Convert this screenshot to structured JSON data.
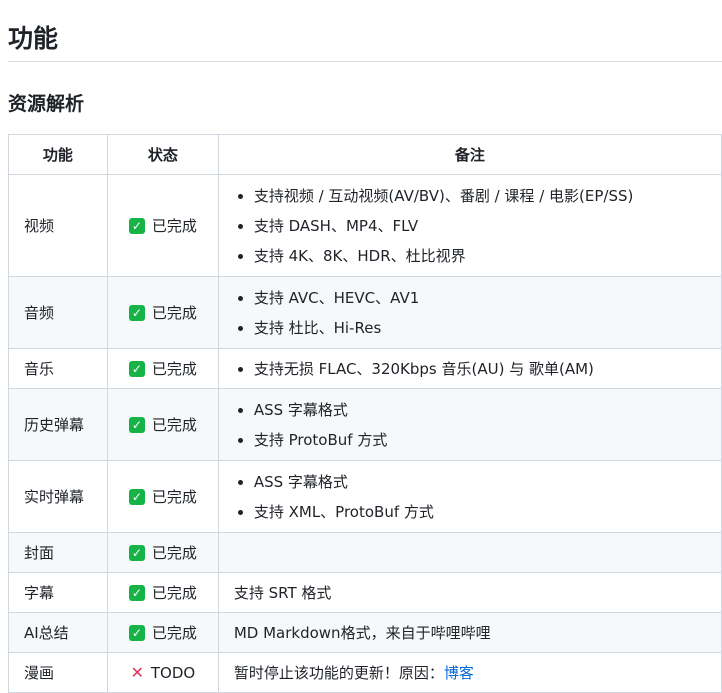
{
  "heading": "功能",
  "subheading": "资源解析",
  "table": {
    "headers": [
      "功能",
      "状态",
      "备注"
    ],
    "done_label": "已完成",
    "todo_label": "TODO",
    "colors": {
      "check": "#16b346",
      "cross": "#e3335a",
      "link": "#0969da"
    },
    "rows": [
      {
        "feature": "视频",
        "notes": [
          "支持视频 / 互动视频(AV/BV)、番剧 / 课程 / 电影(EP/SS)",
          "支持 DASH、MP4、FLV",
          "支持 4K、8K、HDR、杜比视界"
        ]
      },
      {
        "feature": "音频",
        "notes": [
          "支持 AVC、HEVC、AV1",
          "支持 杜比、Hi-Res"
        ]
      },
      {
        "feature": "音乐",
        "notes": [
          "支持无损 FLAC、320Kbps 音乐(AU) 与 歌单(AM)"
        ]
      },
      {
        "feature": "历史弹幕",
        "notes": [
          "ASS 字幕格式",
          "支持 ProtoBuf 方式"
        ]
      },
      {
        "feature": "实时弹幕",
        "notes": [
          "ASS 字幕格式",
          "支持 XML、ProtoBuf 方式"
        ]
      },
      {
        "feature": "封面",
        "text": ""
      },
      {
        "feature": "字幕",
        "text": "支持 SRT 格式"
      },
      {
        "feature": "AI总结",
        "text": "MD Markdown格式，来自于哔哩哔哩"
      },
      {
        "feature": "漫画",
        "text": "暂时停止该功能的更新！原因：",
        "link": "博客"
      }
    ]
  }
}
